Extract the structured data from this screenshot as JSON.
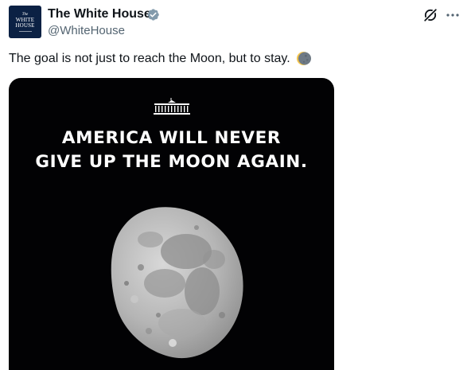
{
  "tweet": {
    "author": {
      "display_name": "The White House",
      "handle": "@WhiteHouse",
      "verified": true,
      "avatar": {
        "line_the": "The",
        "line_1": "WHITE",
        "line_2": "HOUSE"
      }
    },
    "text": "The goal is not just to reach the Moon, but to stay.",
    "emoji": "waning-crescent-moon-icon",
    "media": {
      "headline_line_1": "AMERICA WILL NEVER",
      "headline_line_2": "GIVE UP THE MOON AGAIN."
    }
  },
  "colors": {
    "text": "#0f1419",
    "secondary_text": "#536471",
    "verified_badge": "#829aab",
    "avatar_bg": "#0b2144",
    "media_bg": "#020204"
  }
}
